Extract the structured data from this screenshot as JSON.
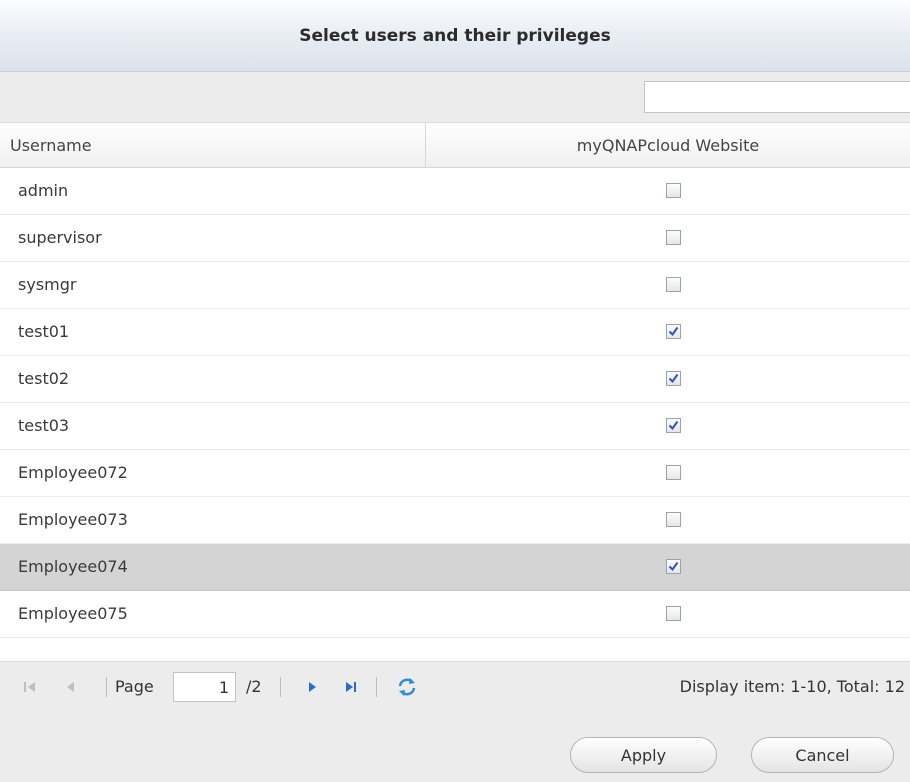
{
  "dialog": {
    "title": "Select users and their privileges"
  },
  "search": {
    "value": "",
    "placeholder": ""
  },
  "grid": {
    "columns": [
      "Username",
      "myQNAPcloud Website"
    ],
    "rows": [
      {
        "username": "admin",
        "checked": false,
        "selected": false
      },
      {
        "username": "supervisor",
        "checked": false,
        "selected": false
      },
      {
        "username": "sysmgr",
        "checked": false,
        "selected": false
      },
      {
        "username": "test01",
        "checked": true,
        "selected": false
      },
      {
        "username": "test02",
        "checked": true,
        "selected": false
      },
      {
        "username": "test03",
        "checked": true,
        "selected": false
      },
      {
        "username": "Employee072",
        "checked": false,
        "selected": false
      },
      {
        "username": "Employee073",
        "checked": false,
        "selected": false
      },
      {
        "username": "Employee074",
        "checked": true,
        "selected": true
      },
      {
        "username": "Employee075",
        "checked": false,
        "selected": false
      }
    ]
  },
  "pager": {
    "page_label": "Page",
    "current_page": "1",
    "total_pages_label": "/2",
    "display_info": "Display item: 1-10, Total: 12",
    "icons": [
      "first-page-icon",
      "prev-page-icon",
      "next-page-icon",
      "last-page-icon",
      "refresh-icon"
    ]
  },
  "buttons": {
    "apply": "Apply",
    "cancel": "Cancel"
  },
  "colors": {
    "accent": "#2a6bd1",
    "disabled_nav": "#b8c0c8",
    "selected_row": "#d4d4d4",
    "panel_bg": "#ececec"
  }
}
